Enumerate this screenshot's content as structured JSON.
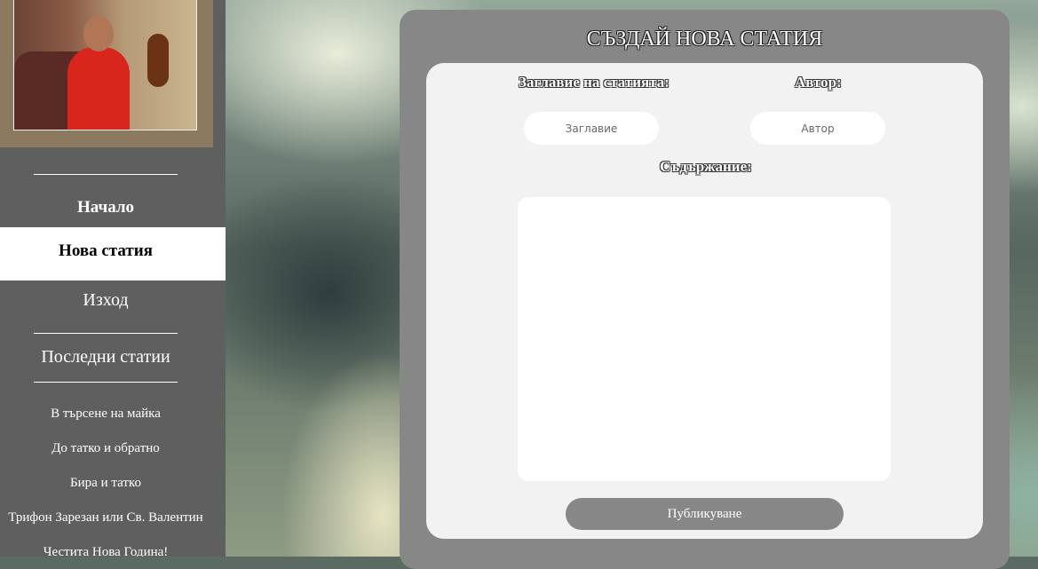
{
  "sidebar": {
    "nav": {
      "home": "Начало",
      "new_article": "Нова статия",
      "logout": "Изход"
    },
    "recent_heading": "Последни статии",
    "recent_articles": [
      "В търсене на майка",
      "До татко и обратно",
      "Бира и татко",
      "Трифон Зарезан или Св. Валентин",
      "Честита Нова Година!"
    ]
  },
  "form": {
    "title": "СЪЗДАЙ НОВА СТАТИЯ",
    "article_title_label": "Заглавие на статията:",
    "article_title_placeholder": "Заглавие",
    "author_label": "Автор:",
    "author_placeholder": "Автор",
    "content_label": "Съдържание:",
    "content_value": "",
    "publish_label": "Публикуване"
  },
  "colors": {
    "sidebar_bg": "#5f5f5f",
    "panel_bg": "#878787",
    "form_bg": "#f2f2f2",
    "active_nav_bg": "#ffffff"
  }
}
